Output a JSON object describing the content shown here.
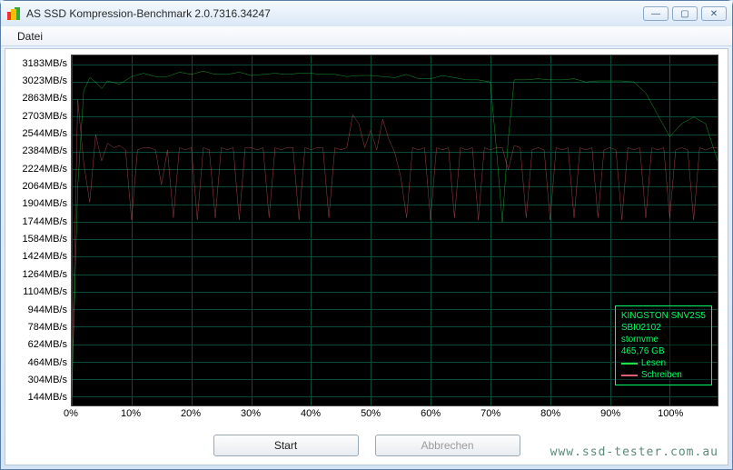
{
  "window": {
    "title": "AS SSD Kompression-Benchmark 2.0.7316.34247",
    "menu": {
      "datei": "Datei"
    },
    "buttons": {
      "start": "Start",
      "cancel": "Abbrechen"
    },
    "win_controls": {
      "min": "—",
      "max": "▢",
      "close": "✕"
    }
  },
  "legend": {
    "device": "KINGSTON SNV2S5",
    "firmware": "SBI02102",
    "driver": "stornvme",
    "capacity": "465,76 GB",
    "read_label": "Lesen",
    "write_label": "Schreiben",
    "read_color": "#20e040",
    "write_color": "#e06070"
  },
  "watermark": "www.ssd-tester.com.au",
  "chart_data": {
    "type": "line",
    "xlabel": "",
    "ylabel": "",
    "x_unit": "%",
    "y_unit": "MB/s",
    "xlim": [
      0,
      108
    ],
    "ylim": [
      64,
      3263
    ],
    "y_ticks": [
      144,
      304,
      464,
      624,
      784,
      944,
      1104,
      1264,
      1424,
      1584,
      1744,
      1904,
      2064,
      2224,
      2384,
      2544,
      2703,
      2863,
      3023,
      3183
    ],
    "x_ticks": [
      0,
      10,
      20,
      30,
      40,
      50,
      60,
      70,
      80,
      90,
      100
    ],
    "series": [
      {
        "name": "Lesen",
        "color": "#20e040",
        "x": [
          0,
          1,
          2,
          3,
          4,
          5,
          6,
          8,
          10,
          12,
          14,
          16,
          18,
          20,
          22,
          24,
          26,
          28,
          30,
          32,
          34,
          36,
          38,
          40,
          42,
          44,
          46,
          48,
          50,
          52,
          54,
          56,
          58,
          60,
          62,
          64,
          66,
          68,
          70,
          71,
          72,
          73,
          74,
          76,
          78,
          80,
          82,
          84,
          86,
          88,
          90,
          92,
          94,
          96,
          98,
          100,
          102,
          104,
          106,
          108
        ],
        "values": [
          140,
          2060,
          2940,
          3060,
          3020,
          2960,
          3030,
          3000,
          3070,
          3100,
          3070,
          3070,
          3110,
          3090,
          3120,
          3090,
          3090,
          3110,
          3080,
          3090,
          3100,
          3090,
          3100,
          3100,
          3090,
          3090,
          3070,
          3080,
          3080,
          3070,
          3060,
          3090,
          3050,
          3050,
          3080,
          3060,
          3040,
          3040,
          3020,
          2420,
          1740,
          2500,
          3040,
          3040,
          3050,
          3040,
          3040,
          3050,
          3020,
          3030,
          3030,
          3030,
          3020,
          2920,
          2720,
          2520,
          2640,
          2700,
          2640,
          2300
        ]
      },
      {
        "name": "Schreiben",
        "color": "#e06070",
        "x": [
          0,
          1,
          2,
          3,
          4,
          5,
          6,
          7,
          8,
          9,
          10,
          11,
          12,
          13,
          14,
          15,
          16,
          17,
          18,
          19,
          20,
          21,
          22,
          23,
          24,
          25,
          26,
          27,
          28,
          29,
          30,
          31,
          32,
          33,
          34,
          35,
          36,
          37,
          38,
          39,
          40,
          41,
          42,
          43,
          44,
          45,
          46,
          47,
          48,
          49,
          50,
          51,
          52,
          53,
          54,
          55,
          56,
          57,
          58,
          59,
          60,
          61,
          62,
          63,
          64,
          65,
          66,
          67,
          68,
          69,
          70,
          71,
          72,
          73,
          74,
          75,
          76,
          77,
          78,
          79,
          80,
          81,
          82,
          83,
          84,
          85,
          86,
          87,
          88,
          89,
          90,
          91,
          92,
          93,
          94,
          95,
          96,
          97,
          98,
          99,
          100,
          101,
          102,
          103,
          104,
          105,
          106,
          107,
          108
        ],
        "values": [
          140,
          2860,
          2280,
          1920,
          2540,
          2300,
          2460,
          2420,
          2440,
          2400,
          1760,
          2400,
          2420,
          2420,
          2400,
          2080,
          2400,
          1780,
          2420,
          2400,
          2420,
          1760,
          2420,
          2400,
          1780,
          2420,
          2400,
          2420,
          1760,
          2420,
          2420,
          2400,
          2420,
          1780,
          2420,
          2400,
          2420,
          2420,
          1760,
          2420,
          2400,
          2420,
          2420,
          1780,
          2420,
          2400,
          2420,
          2720,
          2640,
          2420,
          2580,
          2400,
          2680,
          2500,
          2380,
          2160,
          1780,
          2420,
          2400,
          2420,
          1760,
          2420,
          2400,
          2420,
          1780,
          2420,
          2400,
          2420,
          1760,
          2420,
          2400,
          2420,
          2420,
          2220,
          2440,
          2420,
          1780,
          2400,
          2420,
          2400,
          1760,
          2420,
          2400,
          2420,
          1780,
          2420,
          2400,
          2420,
          1780,
          2400,
          2420,
          2400,
          1760,
          2420,
          2400,
          2420,
          1780,
          2420,
          2400,
          2420,
          1780,
          2400,
          2420,
          2400,
          1760,
          2420,
          2400,
          2420,
          2420
        ]
      }
    ]
  }
}
